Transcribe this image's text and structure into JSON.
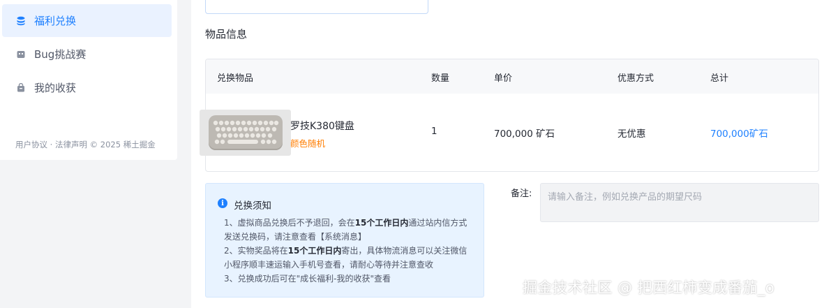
{
  "sidebar": {
    "items": [
      {
        "label": "福利兑换",
        "icon": "database-icon",
        "active": true
      },
      {
        "label": "Bug挑战赛",
        "icon": "bug-icon",
        "active": false
      },
      {
        "label": "我的收获",
        "icon": "bag-icon",
        "active": false
      }
    ],
    "footer": "用户协议 · 法律声明 © 2025 稀土掘金"
  },
  "section_title": "物品信息",
  "table": {
    "headers": [
      "兑换物品",
      "数量",
      "单价",
      "优惠方式",
      "总计"
    ],
    "row": {
      "product_name": "罗技K380键盘",
      "product_note": "颜色随机",
      "quantity": "1",
      "unit_price": "700,000 矿石",
      "discount": "无优惠",
      "total": "700,000矿石"
    }
  },
  "notice": {
    "title": "兑换须知",
    "line1_a": "1、虚拟商品兑换后不予退回，会在",
    "line1_b": "15个工作日内",
    "line1_c": "通过站内信方式发送兑换码，请注意查看【系统消息】",
    "line2_a": "2、实物奖品将在",
    "line2_b": "15个工作日内",
    "line2_c": "寄出，具体物流消息可以关注微信小程序顺丰速运输入手机号查看，请耐心等待并注意查收",
    "line3": "3、兑换成功后可在\"成长福利-我的收获\"查看"
  },
  "remark": {
    "label": "备注:",
    "placeholder": "请输入备注，例如兑换产品的期望尺码"
  },
  "watermark": "掘金技术社区 @ 把西红柿变成番茄_o",
  "colors": {
    "accent": "#1e80ff",
    "note": "#ff7d00",
    "notice_bg": "#e8f3ff"
  }
}
